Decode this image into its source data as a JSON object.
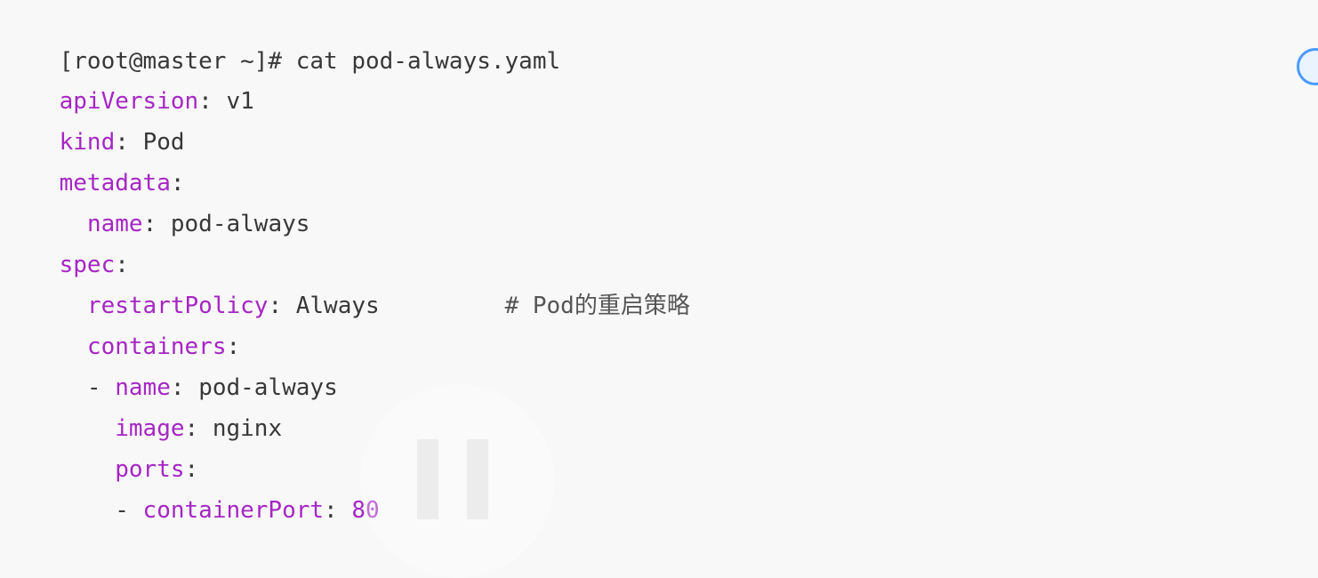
{
  "terminal": {
    "command": "[root@master ~]# cat pod-always.yaml"
  },
  "yaml": {
    "apiVersion_key": "apiVersion",
    "apiVersion_sep": ": ",
    "apiVersion_value": "v1",
    "kind_key": "kind",
    "kind_sep": ": ",
    "kind_value": "Pod",
    "metadata_key": "metadata",
    "metadata_sep": ":",
    "meta_indent": "  ",
    "meta_name_key": "name",
    "meta_name_sep": ": ",
    "meta_name_value": "pod-always",
    "spec_key": "spec",
    "spec_sep": ":",
    "restart_indent": "  ",
    "restartPolicy_key": "restartPolicy",
    "restartPolicy_sep": ": ",
    "restartPolicy_value": "Always",
    "restart_spacer": "         ",
    "restartPolicy_comment_prefix": "# Pod",
    "restartPolicy_comment_cjk": "的重启策略",
    "containers_indent": "  ",
    "containers_key": "containers",
    "containers_sep": ":",
    "item_prefix": "  - ",
    "container_name_key": "name",
    "container_name_sep": ": ",
    "container_name_value": "pod-always",
    "image_indent": "    ",
    "image_key": "image",
    "image_sep": ": ",
    "image_value": "nginx",
    "ports_indent": "    ",
    "ports_key": "ports",
    "ports_sep": ":",
    "port_prefix": "    - ",
    "containerPort_key": "containerPort",
    "containerPort_sep": ": ",
    "containerPort_value": "80"
  },
  "colors": {
    "background": "#f8f8f8",
    "key": "#a626c4",
    "text": "#383838",
    "widget_accent": "#4a9bff"
  },
  "icons": {
    "edge_widget": "circle-icon",
    "overlay": "pause-icon"
  }
}
